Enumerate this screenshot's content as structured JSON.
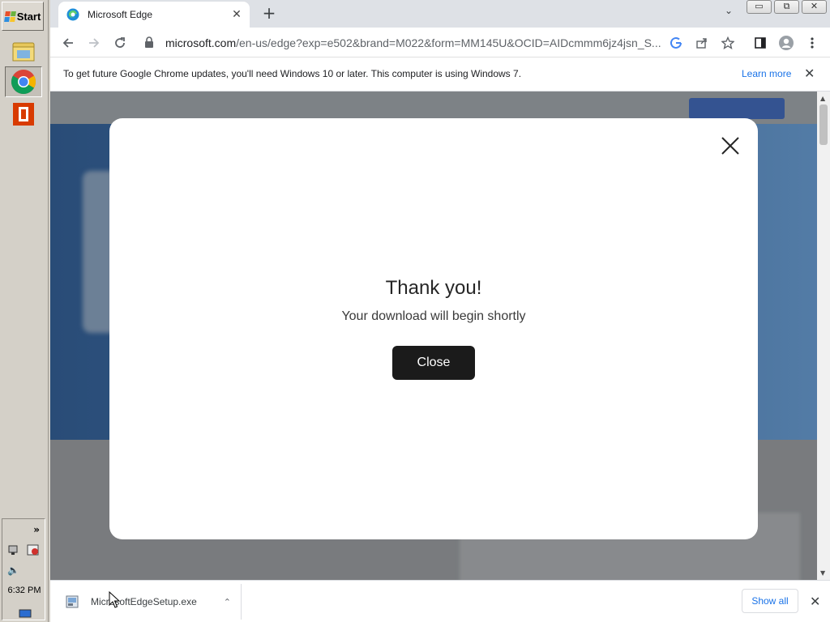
{
  "taskbar": {
    "start_label": "Start",
    "clock": "6:32 PM",
    "tray_expand": "»",
    "icons": [
      "folder-icon",
      "chrome-icon",
      "office-icon"
    ]
  },
  "browser": {
    "tab_title": "Microsoft Edge",
    "tab_close": "✕",
    "new_tab": "+",
    "tab_search": "⌄",
    "window_buttons": [
      "▭",
      "⧉",
      "✕"
    ],
    "url_host": "microsoft.com",
    "url_rest": "/en-us/edge?exp=e502&brand=M022&form=MM145U&OCID=AIDcmmm6jz4jsn_S...",
    "infobar_message": "To get future Google Chrome updates, you'll need Windows 10 or later. This computer is using Windows 7.",
    "infobar_link": "Learn more",
    "infobar_close": "✕"
  },
  "modal": {
    "title": "Thank you!",
    "subtitle": "Your download will begin shortly",
    "close_button": "Close"
  },
  "downloads": {
    "file_name": "MicrosoftEdgeSetup.exe",
    "caret": "⌃",
    "show_all": "Show all",
    "close": "✕"
  },
  "colors": {
    "accent_link": "#1a73e8",
    "modal_button": "#1b1b1b",
    "hero_blue": "#3f6aa0"
  }
}
